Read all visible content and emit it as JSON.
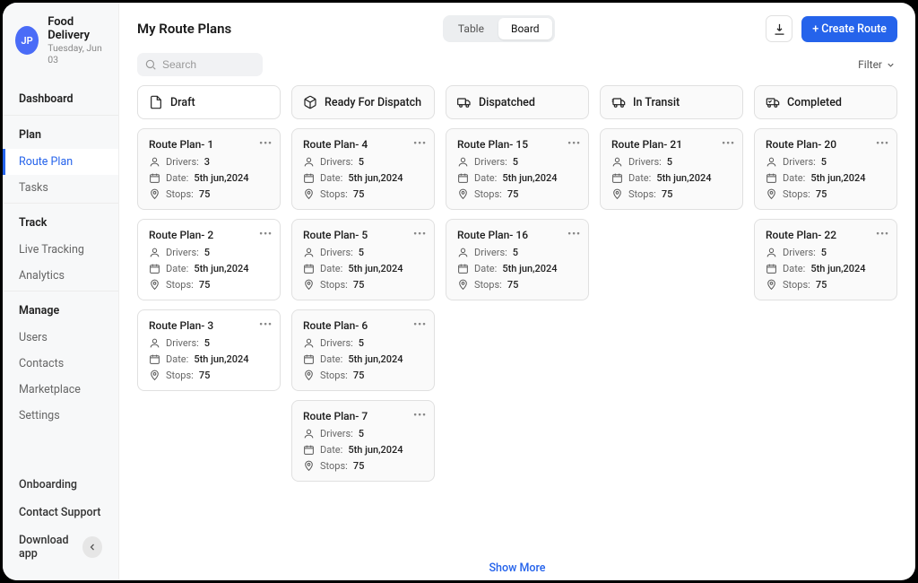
{
  "brand": {
    "initials": "JP",
    "name": "Food Delivery",
    "subtitle": "Tuesday, Jun 03"
  },
  "nav": {
    "dashboard": "Dashboard",
    "plan": {
      "head": "Plan",
      "route_plan": "Route Plan",
      "tasks": "Tasks"
    },
    "track": {
      "head": "Track",
      "live_tracking": "Live Tracking",
      "analytics": "Analytics"
    },
    "manage": {
      "head": "Manage",
      "users": "Users",
      "contacts": "Contacts",
      "marketplace": "Marketplace",
      "settings": "Settings"
    }
  },
  "foot": {
    "onboarding": "Onboarding",
    "support": "Contact Support",
    "download": "Download app"
  },
  "header": {
    "title": "My Route Plans",
    "toggle_table": "Table",
    "toggle_board": "Board",
    "create": "+ Create Route"
  },
  "toolbar": {
    "search_placeholder": "Search",
    "filter": "Filter",
    "show_more": "Show More"
  },
  "labels": {
    "drivers": "Drivers:",
    "date": "Date:",
    "stops": "Stops:"
  },
  "columns": {
    "draft": {
      "label": "Draft",
      "cards": [
        {
          "title": "Route Plan- 1",
          "drivers": "3",
          "date": "5th jun,2024",
          "stops": "75"
        },
        {
          "title": "Route Plan- 2",
          "drivers": "5",
          "date": "5th jun,2024",
          "stops": "75"
        },
        {
          "title": "Route Plan- 3",
          "drivers": "5",
          "date": "5th jun,2024",
          "stops": "75"
        }
      ]
    },
    "ready": {
      "label": "Ready For Dispatch",
      "cards": [
        {
          "title": "Route Plan- 4",
          "drivers": "5",
          "date": "5th jun,2024",
          "stops": "75"
        },
        {
          "title": "Route Plan- 5",
          "drivers": "5",
          "date": "5th jun,2024",
          "stops": "75"
        },
        {
          "title": "Route Plan- 6",
          "drivers": "5",
          "date": "5th jun,2024",
          "stops": "75"
        },
        {
          "title": "Route Plan- 7",
          "drivers": "5",
          "date": "5th jun,2024",
          "stops": "75"
        }
      ]
    },
    "dispatched": {
      "label": "Dispatched",
      "cards": [
        {
          "title": "Route Plan- 15",
          "drivers": "5",
          "date": "5th jun,2024",
          "stops": "75"
        },
        {
          "title": "Route Plan- 16",
          "drivers": "5",
          "date": "5th jun,2024",
          "stops": "75"
        }
      ]
    },
    "transit": {
      "label": "In Transit",
      "cards": [
        {
          "title": "Route Plan- 21",
          "drivers": "5",
          "date": "5th jun,2024",
          "stops": "75"
        }
      ]
    },
    "completed": {
      "label": "Completed",
      "cards": [
        {
          "title": "Route Plan- 20",
          "drivers": "5",
          "date": "5th jun,2024",
          "stops": "75"
        },
        {
          "title": "Route Plan- 22",
          "drivers": "5",
          "date": "5th jun,2024",
          "stops": "75"
        }
      ]
    }
  }
}
